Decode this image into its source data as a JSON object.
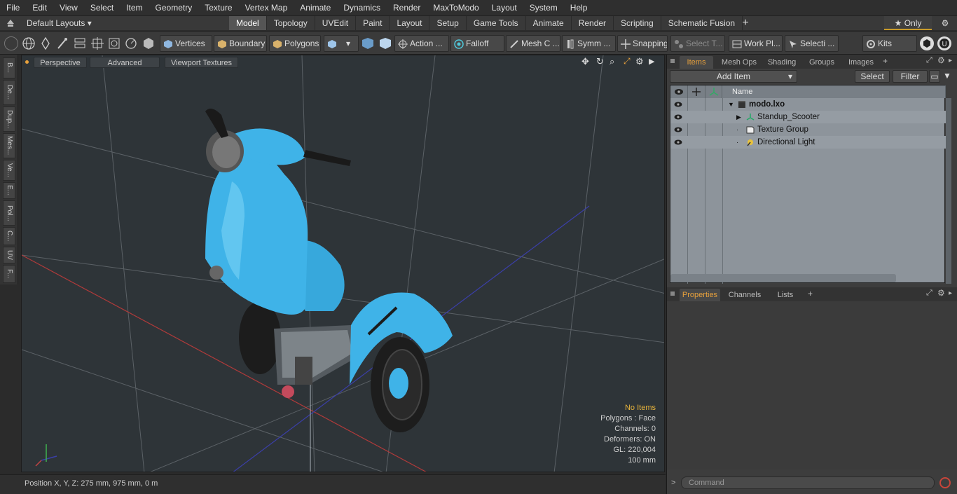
{
  "menu": [
    "File",
    "Edit",
    "View",
    "Select",
    "Item",
    "Geometry",
    "Texture",
    "Vertex Map",
    "Animate",
    "Dynamics",
    "Render",
    "MaxToModo",
    "Layout",
    "System",
    "Help"
  ],
  "layout_selector": "Default Layouts ▾",
  "mode_tabs": [
    {
      "label": "Model",
      "active": true
    },
    {
      "label": "Topology",
      "active": false
    },
    {
      "label": "UVEdit",
      "active": false
    },
    {
      "label": "Paint",
      "active": false
    },
    {
      "label": "Layout",
      "active": false
    },
    {
      "label": "Setup",
      "active": false
    },
    {
      "label": "Game Tools",
      "active": false
    },
    {
      "label": "Animate",
      "active": false
    },
    {
      "label": "Render",
      "active": false
    },
    {
      "label": "Scripting",
      "active": false
    },
    {
      "label": "Schematic Fusion",
      "active": false
    }
  ],
  "only_label": "★  Only",
  "toolbar": {
    "vertices": "Vertices",
    "boundary": "Boundary",
    "polygons": "Polygons",
    "action": "Action",
    "falloff": "Falloff",
    "mesh": "Mesh C ...",
    "symm": "Symm ...",
    "snapping": "Snapping",
    "select_t": "Select T...",
    "work_pl": "Work Pl...",
    "selecti": "Selecti ...",
    "kits": "Kits"
  },
  "left_tabs": [
    "B...",
    "De...",
    "Dup...",
    "Mes...",
    "Ve...",
    "E...",
    "Pol...",
    "C...",
    "UV",
    "F..."
  ],
  "viewport": {
    "view_mode": "Perspective",
    "advanced": "Advanced",
    "textures": "Viewport Textures",
    "info": {
      "no_items": "No Items",
      "polygons": "Polygons : Face",
      "channels": "Channels: 0",
      "deformers": "Deformers: ON",
      "gl": "GL: 220,004",
      "scale": "100 mm"
    }
  },
  "status": "Position X, Y, Z:   275 mm, 975 mm, 0 m",
  "items_panel": {
    "tabs": [
      "Items",
      "Mesh Ops",
      "Shading",
      "Groups",
      "Images"
    ],
    "add_item": "Add Item",
    "select": "Select",
    "filter": "Filter",
    "name_header": "Name",
    "rows": [
      {
        "label": "modo.lxo",
        "bold": true,
        "indent": 0
      },
      {
        "label": "Standup_Scooter",
        "bold": false,
        "indent": 1
      },
      {
        "label": "Texture Group",
        "bold": false,
        "indent": 1
      },
      {
        "label": "Directional Light",
        "bold": false,
        "indent": 1
      }
    ]
  },
  "properties_panel": {
    "tabs": [
      "Properties",
      "Channels",
      "Lists"
    ]
  },
  "command_placeholder": "Command",
  "colors": {
    "accent": "#e8a13c",
    "scooter": "#3fb3e8",
    "viewport_bg": "#2e3438"
  }
}
